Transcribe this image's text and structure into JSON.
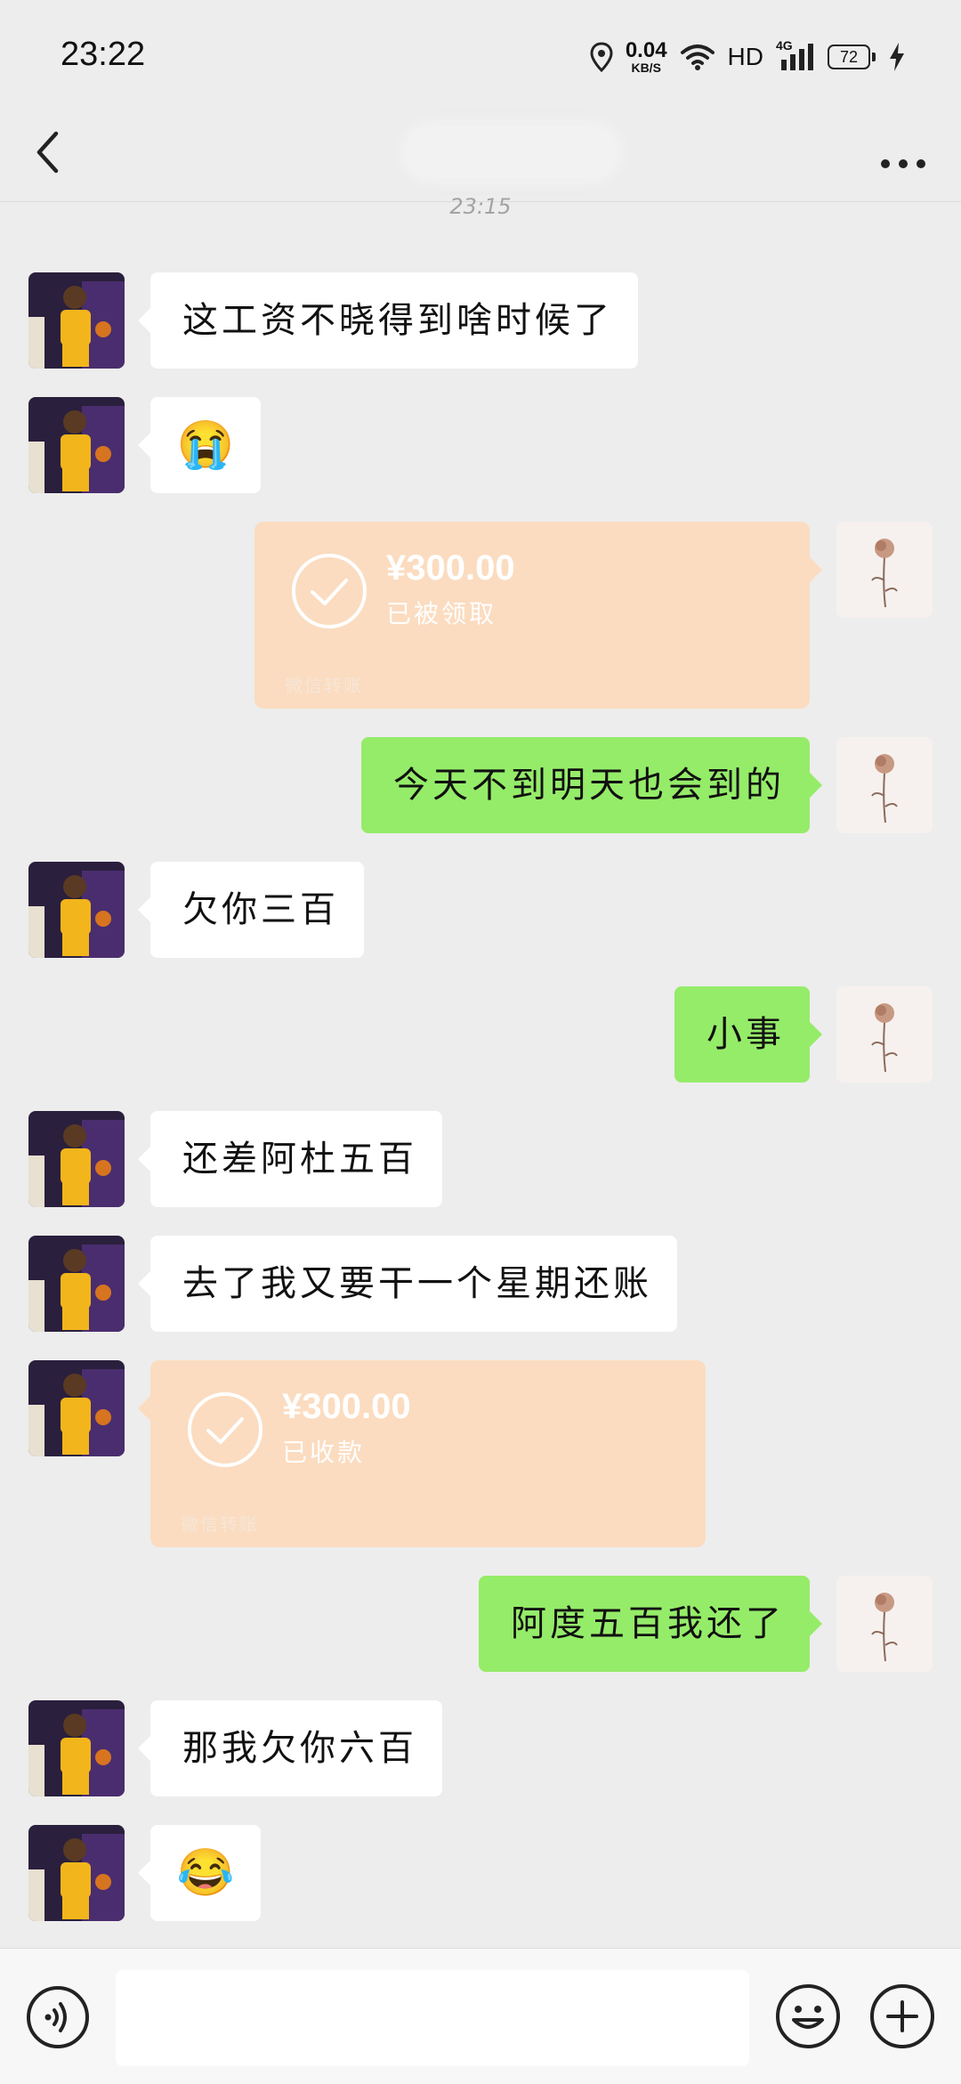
{
  "status_bar": {
    "time": "23:22",
    "net_speed_value": "0.04",
    "net_speed_unit": "KB/S",
    "hd_label": "HD",
    "network_label": "4G",
    "battery_level": "72"
  },
  "chat": {
    "timestamp": "23:15",
    "messages": [
      {
        "side": "in",
        "type": "text",
        "text": "这工资不晓得到啥时候了"
      },
      {
        "side": "in",
        "type": "emoji",
        "text": "😭"
      },
      {
        "side": "out",
        "type": "transfer",
        "amount": "¥300.00",
        "status": "已被领取",
        "footer": "微信转账"
      },
      {
        "side": "out",
        "type": "text",
        "text": "今天不到明天也会到的"
      },
      {
        "side": "in",
        "type": "text",
        "text": "欠你三百"
      },
      {
        "side": "out",
        "type": "text",
        "text": "小事"
      },
      {
        "side": "in",
        "type": "text",
        "text": "还差阿杜五百"
      },
      {
        "side": "in",
        "type": "text",
        "text": "去了我又要干一个星期还账"
      },
      {
        "side": "in",
        "type": "transfer",
        "amount": "¥300.00",
        "status": "已收款",
        "footer": "微信转账"
      },
      {
        "side": "out",
        "type": "text",
        "text": "阿度五百我还了"
      },
      {
        "side": "in",
        "type": "text",
        "text": "那我欠你六百"
      },
      {
        "side": "in",
        "type": "emoji",
        "text": "😂"
      }
    ]
  },
  "icons": {
    "back": "chevron-left-icon",
    "more": "more-dots-icon",
    "voice": "voice-icon",
    "emoji": "emoji-icon",
    "plus": "plus-icon"
  },
  "colors": {
    "outgoing_bubble": "#95ec69",
    "incoming_bubble": "#ffffff",
    "transfer_card": "#fbdcc0",
    "background": "#ededed"
  }
}
